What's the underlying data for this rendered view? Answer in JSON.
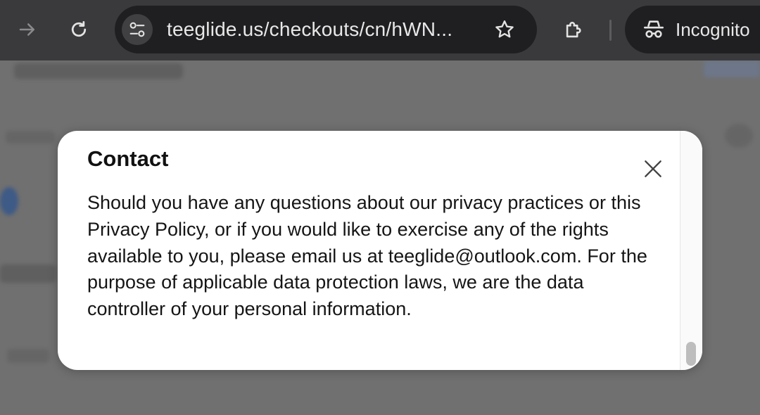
{
  "browser": {
    "url": "teeglide.us/checkouts/cn/hWN...",
    "profile_label": "Incognito",
    "icons": {
      "forward": "arrow-right-icon",
      "reload": "reload-icon",
      "site_info": "tune-icon",
      "bookmark": "star-icon",
      "extensions": "puzzle-icon",
      "incognito": "incognito-icon"
    }
  },
  "modal": {
    "heading": "Contact",
    "body": "Should you have any questions about our privacy practices or this Privacy Policy, or if you would like to exercise any of the rights available to you, please email us at teeglide@outlook.com. For the purpose of applicable data protection laws, we are the data controller of your personal information.",
    "close_icon": "close-icon"
  }
}
